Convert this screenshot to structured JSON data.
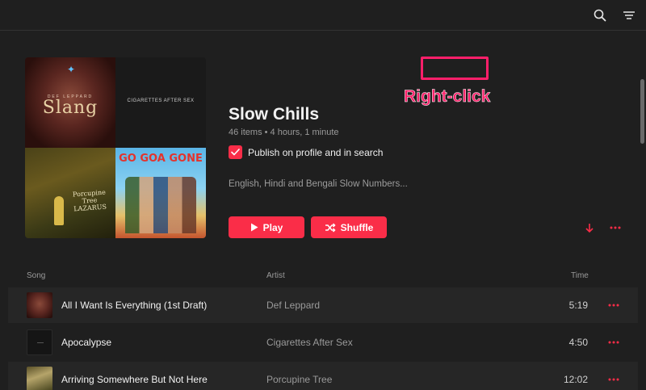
{
  "playlist": {
    "title": "Slow Chills",
    "meta": "46 items • 4 hours, 1 minute",
    "publish_label": "Publish on profile and in search",
    "publish_checked": true,
    "description": "English, Hindi and Bengali Slow Numbers...",
    "play_label": "Play",
    "shuffle_label": "Shuffle"
  },
  "artwork": {
    "tile1_band": "DEF LEPPARD",
    "tile1_title": "Slang",
    "tile2_text": "CIGARETTES AFTER SEX",
    "tile3_text": "Porcupine Tree LAZARUS",
    "tile4_text": "GO GOA GONE"
  },
  "annotation": {
    "label": "Right-click"
  },
  "columns": {
    "song": "Song",
    "artist": "Artist",
    "time": "Time"
  },
  "songs": [
    {
      "title": "All I Want Is Everything (1st Draft)",
      "artist": "Def Leppard",
      "time": "5:19"
    },
    {
      "title": "Apocalypse",
      "artist": "Cigarettes After Sex",
      "time": "4:50"
    },
    {
      "title": "Arriving Somewhere But Not Here",
      "artist": "Porcupine Tree",
      "time": "12:02"
    }
  ],
  "icons": {
    "search": "search-icon",
    "menu": "menu-icon",
    "download": "download-icon",
    "more": "more-icon",
    "play": "play-icon",
    "shuffle": "shuffle-icon",
    "check": "check-icon"
  },
  "colors": {
    "accent": "#fa2d48",
    "annotation": "#ff1f6a",
    "background": "#1f1f1f"
  }
}
